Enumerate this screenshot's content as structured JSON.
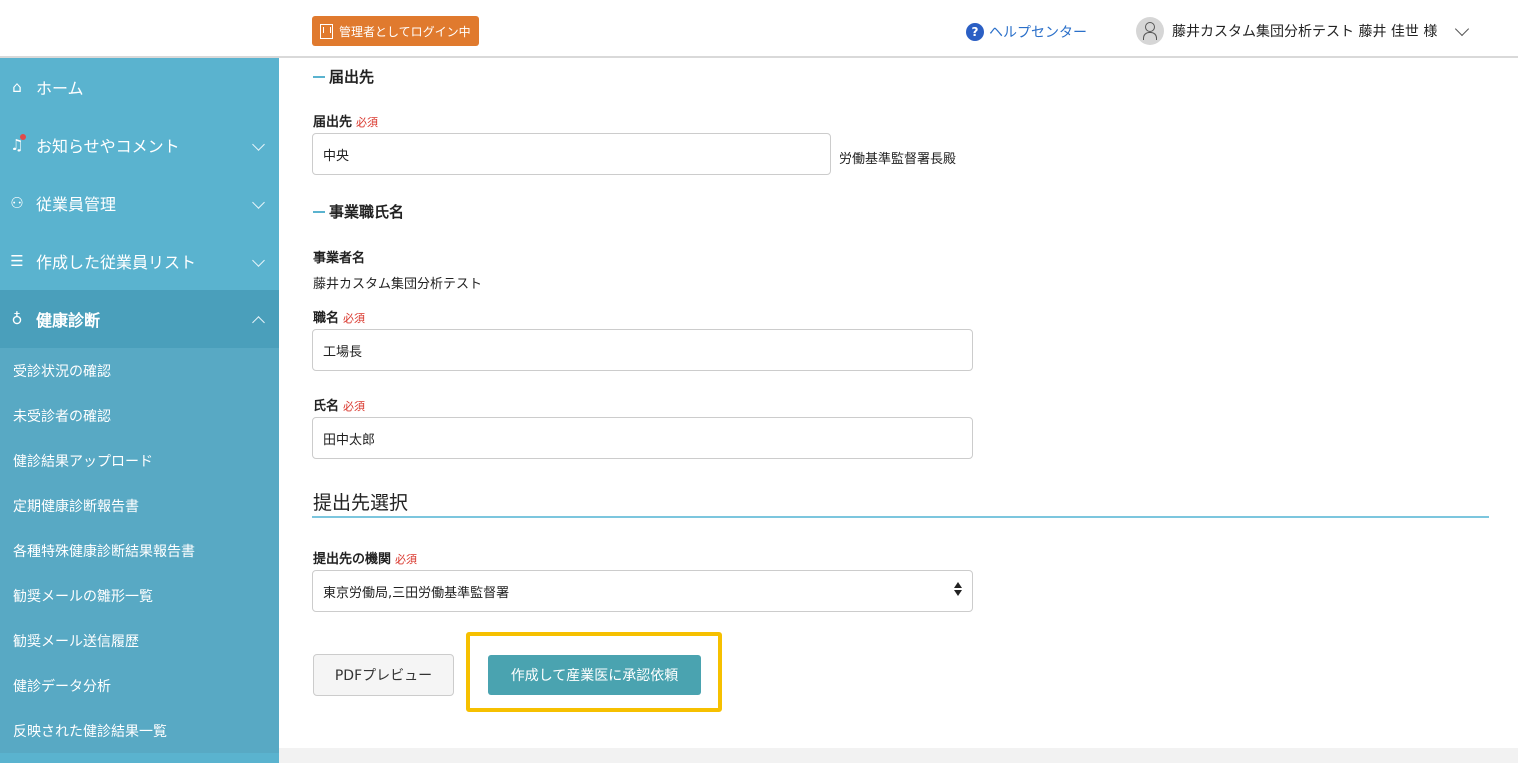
{
  "header": {
    "admin_badge": "管理者としてログイン中",
    "help_label": "ヘルプセンター",
    "user_name": "藤井カスタム集団分析テスト 藤井 佳世 様"
  },
  "sidebar": {
    "items": [
      {
        "label": "ホーム",
        "icon": "home-icon"
      },
      {
        "label": "お知らせやコメント",
        "icon": "bell-icon"
      },
      {
        "label": "従業員管理",
        "icon": "people-icon"
      },
      {
        "label": "作成した従業員リスト",
        "icon": "list-person-icon"
      },
      {
        "label": "健康診断",
        "icon": "stethoscope-icon"
      }
    ],
    "sub_items": [
      "受診状況の確認",
      "未受診者の確認",
      "健診結果アップロード",
      "定期健康診断報告書",
      "各種特殊健康診断結果報告書",
      "勧奨メールの雛形一覧",
      "勧奨メール送信履歴",
      "健診データ分析",
      "反映された健診結果一覧"
    ]
  },
  "form": {
    "section_todokede": "届出先",
    "todokede_label": "届出先",
    "required": "必須",
    "todokede_value": "中央",
    "todokede_suffix": "労働基準監督署長殿",
    "section_jigyo": "事業職氏名",
    "jigyosha_label": "事業者名",
    "jigyosha_value": "藤井カスタム集団分析テスト",
    "shokumei_label": "職名",
    "shokumei_value": "工場長",
    "shimei_label": "氏名",
    "shimei_value": "田中太郎",
    "submit_section_title": "提出先選択",
    "kikan_label": "提出先の機関",
    "kikan_value": "東京労働局,三田労働基準監督署",
    "preview_button": "PDFプレビュー",
    "submit_button": "作成して産業医に承認依頼"
  },
  "colors": {
    "sidebar": "#5ab3cf",
    "admin_badge": "#e07a2e",
    "submit_button": "#4aa3b0",
    "highlight": "#f6c000",
    "required": "#d9352b"
  }
}
